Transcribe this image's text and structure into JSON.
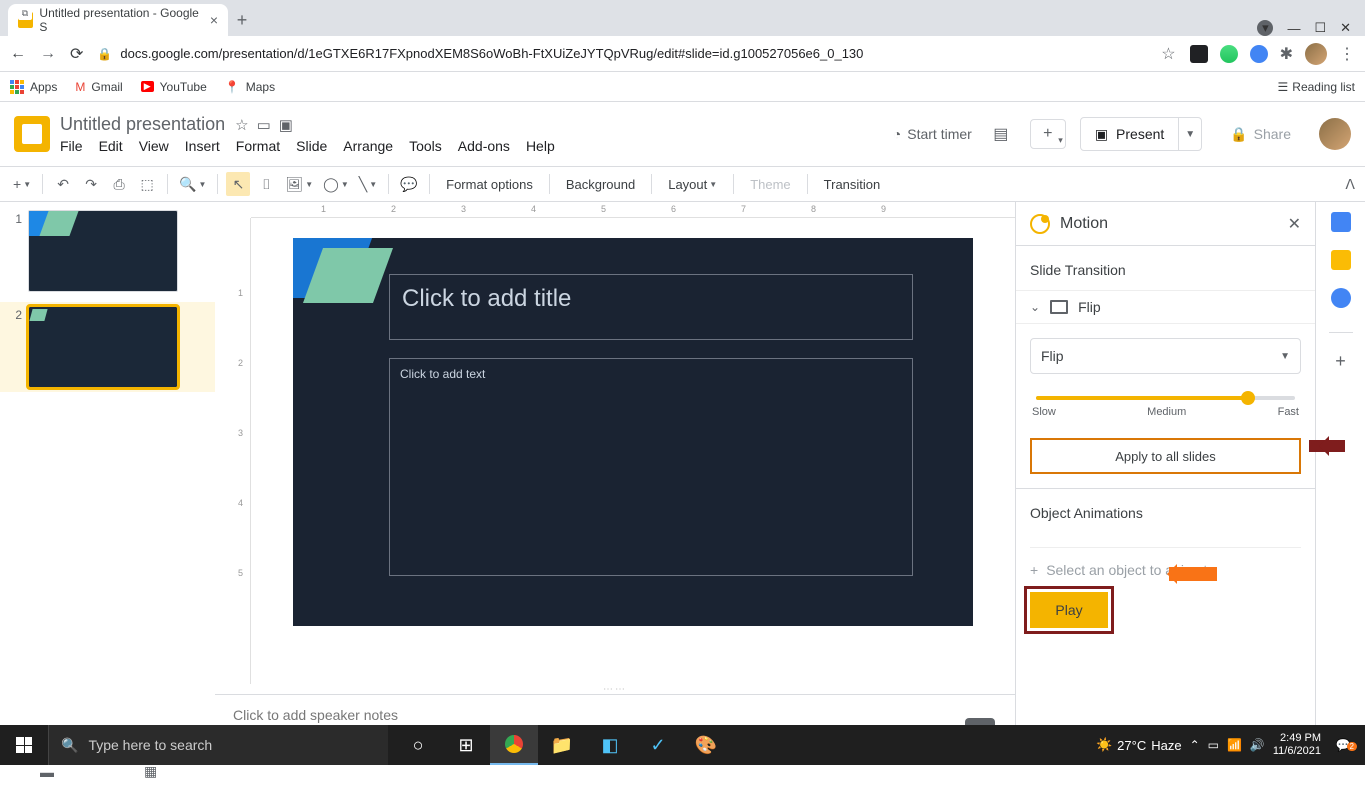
{
  "browser": {
    "tab_title": "Untitled presentation - Google S",
    "url": "docs.google.com/presentation/d/1eGTXE6R17FXpnodXEM8S6oWoBh-FtXUiZeJYTQpVRug/edit#slide=id.g100527056e6_0_130"
  },
  "bookmarks": {
    "apps": "Apps",
    "gmail": "Gmail",
    "youtube": "YouTube",
    "maps": "Maps",
    "reading_list": "Reading list"
  },
  "doc": {
    "title": "Untitled presentation"
  },
  "menus": {
    "file": "File",
    "edit": "Edit",
    "view": "View",
    "insert": "Insert",
    "format": "Format",
    "slide": "Slide",
    "arrange": "Arrange",
    "tools": "Tools",
    "addons": "Add-ons",
    "help": "Help"
  },
  "header": {
    "start_timer": "Start timer",
    "present": "Present",
    "share": "Share"
  },
  "toolbar": {
    "format_options": "Format options",
    "background": "Background",
    "layout": "Layout",
    "theme": "Theme",
    "transition": "Transition"
  },
  "filmstrip": {
    "n1": "1",
    "n2": "2"
  },
  "slide": {
    "title_ph": "Click to add title",
    "text_ph": "Click to add text"
  },
  "notes": {
    "placeholder": "Click to add speaker notes"
  },
  "motion": {
    "title": "Motion",
    "section_transition": "Slide Transition",
    "flip": "Flip",
    "select_value": "Flip",
    "slow": "Slow",
    "medium": "Medium",
    "fast": "Fast",
    "apply_all": "Apply to all slides",
    "section_obj": "Object Animations",
    "select_obj": "Select an object to animate",
    "play": "Play"
  },
  "ruler_h": {
    "m1": "1",
    "m2": "2",
    "m3": "3",
    "m4": "4",
    "m5": "5",
    "m6": "6",
    "m7": "7",
    "m8": "8",
    "m9": "9"
  },
  "ruler_v": {
    "m1": "1",
    "m2": "2",
    "m3": "3",
    "m4": "4",
    "m5": "5"
  },
  "taskbar": {
    "search_ph": "Type here to search",
    "temp": "27°C",
    "cond": "Haze",
    "time": "2:49 PM",
    "date": "11/6/2021",
    "notif_count": "2"
  }
}
